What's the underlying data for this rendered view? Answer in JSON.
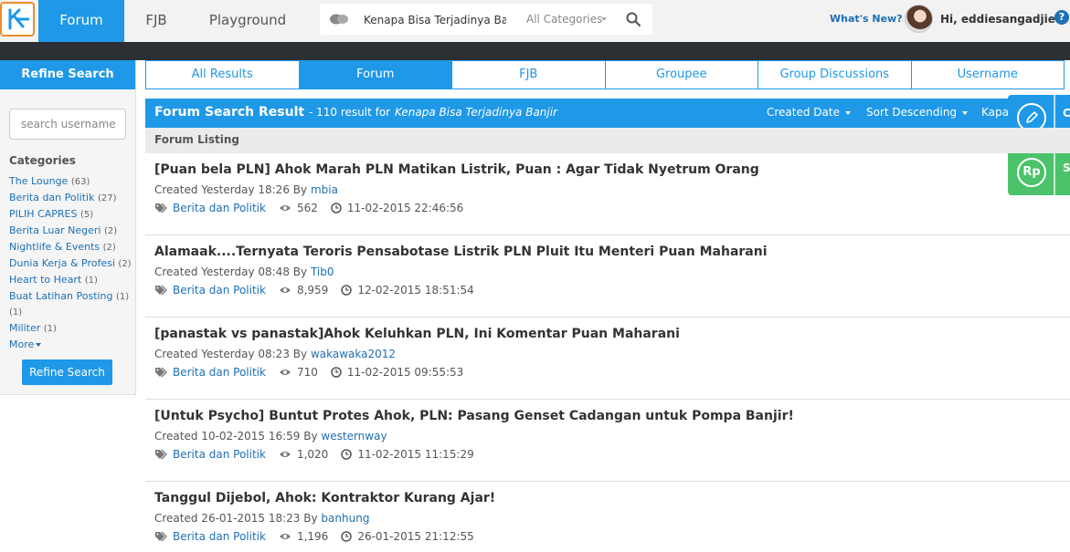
{
  "nav": {
    "logo_icon": "kaskus-logo-icon",
    "items": [
      {
        "label": "Forum",
        "active": true
      },
      {
        "label": "FJB",
        "active": false
      },
      {
        "label": "Playground",
        "active": false
      }
    ]
  },
  "search": {
    "query": "Kenapa Bisa Terjadinya Banjir",
    "category": "All Categories"
  },
  "user": {
    "whats_new": "What's New?",
    "greeting": "Hi, eddiesangadjie"
  },
  "sidebar": {
    "title": "Refine Search",
    "username_placeholder": "search username",
    "categories_title": "Categories",
    "categories": [
      {
        "name": "The Lounge",
        "count": "(63)"
      },
      {
        "name": "Berita dan Politik",
        "count": "(27)"
      },
      {
        "name": "PILIH CAPRES",
        "count": "(5)"
      },
      {
        "name": "Berita Luar Negeri",
        "count": "(2)"
      },
      {
        "name": "Nightlife & Events",
        "count": "(2)"
      },
      {
        "name": "Dunia Kerja & Profesi",
        "count": "(2)"
      },
      {
        "name": "Heart to Heart",
        "count": "(1)"
      },
      {
        "name": "Buat Latihan Posting",
        "count": "(1)"
      },
      {
        "name": "",
        "count": "(1)"
      },
      {
        "name": "Militer",
        "count": "(1)"
      }
    ],
    "more_label": "More",
    "refine_button": "Refine Search"
  },
  "tabs": [
    {
      "label": "All Results",
      "active": false
    },
    {
      "label": "Forum",
      "active": true
    },
    {
      "label": "FJB",
      "active": false
    },
    {
      "label": "Groupee",
      "active": false
    },
    {
      "label": "Group Discussions",
      "active": false
    },
    {
      "label": "Username",
      "active": false
    }
  ],
  "results_header": {
    "title": "Forum Search Result",
    "count_text": "- 110 result for",
    "query": "Kenapa Bisa Terjadinya Banjir",
    "sort_by": "Created Date",
    "sort_order": "Sort Descending",
    "sort_extra": "Kapa"
  },
  "listing_label": "Forum Listing",
  "threads": [
    {
      "title": "[Puan bela PLN] Ahok Marah PLN Matikan Listrik, Puan : Agar Tidak Nyetrum Orang",
      "created": "Created Yesterday 18:26 By",
      "author": "mbia",
      "category": "Berita dan Politik",
      "views": "562",
      "last_post": "11-02-2015 22:46:56"
    },
    {
      "title": "Alamaak....Ternyata Teroris Pensabotase Listrik PLN Pluit Itu Menteri Puan Maharani",
      "created": "Created Yesterday 08:48 By",
      "author": "Tib0",
      "category": "Berita dan Politik",
      "views": "8,959",
      "last_post": "12-02-2015 18:51:54"
    },
    {
      "title": "[panastak vs panastak]Ahok Keluhkan PLN, Ini Komentar Puan Maharani",
      "created": "Created Yesterday 08:23 By",
      "author": "wakawaka2012",
      "category": "Berita dan Politik",
      "views": "710",
      "last_post": "11-02-2015 09:55:53"
    },
    {
      "title": "[Untuk Psycho] Buntut Protes Ahok, PLN: Pasang Genset Cadangan untuk Pompa Banjir!",
      "created": "Created 10-02-2015 16:59 By",
      "author": "westernway",
      "category": "Berita dan Politik",
      "views": "1,020",
      "last_post": "11-02-2015 11:15:29"
    },
    {
      "title": "Tanggul Dijebol, Ahok: Kontraktor Kurang Ajar!",
      "created": "Created 26-01-2015 18:23 By",
      "author": "banhung",
      "category": "Berita dan Politik",
      "views": "1,196",
      "last_post": "26-01-2015 21:12:55"
    }
  ],
  "float_buttons": [
    {
      "icon": "pencil-icon",
      "edge_label": "C"
    },
    {
      "icon": "rupiah-icon",
      "glyph": "Rp",
      "edge_label": "S"
    }
  ],
  "colors": {
    "accent": "#1e98e7",
    "link": "#1e6fb3",
    "green": "#4cc36a",
    "dark_strip": "#2c3035"
  }
}
